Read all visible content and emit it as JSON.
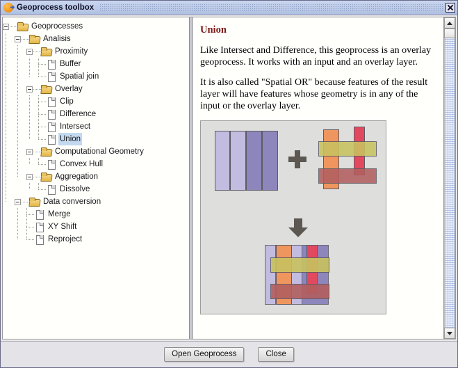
{
  "window": {
    "title": "Geoprocess toolbox",
    "app_icon": "gvsig-logo-icon",
    "close_label": "close-icon"
  },
  "tree": {
    "items": [
      {
        "label": "Geoprocesses",
        "depth": 0,
        "type": "folder",
        "expanded": true,
        "selected": false
      },
      {
        "label": "Analisis",
        "depth": 1,
        "type": "folder",
        "expanded": true,
        "selected": false
      },
      {
        "label": "Proximity",
        "depth": 2,
        "type": "folder",
        "expanded": true,
        "selected": false
      },
      {
        "label": "Buffer",
        "depth": 3,
        "type": "doc",
        "expanded": false,
        "selected": false
      },
      {
        "label": "Spatial join",
        "depth": 3,
        "type": "doc",
        "expanded": false,
        "selected": false
      },
      {
        "label": "Overlay",
        "depth": 2,
        "type": "folder",
        "expanded": true,
        "selected": false
      },
      {
        "label": "Clip",
        "depth": 3,
        "type": "doc",
        "expanded": false,
        "selected": false
      },
      {
        "label": "Difference",
        "depth": 3,
        "type": "doc",
        "expanded": false,
        "selected": false
      },
      {
        "label": "Intersect",
        "depth": 3,
        "type": "doc",
        "expanded": false,
        "selected": false
      },
      {
        "label": "Union",
        "depth": 3,
        "type": "doc",
        "expanded": false,
        "selected": true
      },
      {
        "label": "Computational Geometry",
        "depth": 2,
        "type": "folder",
        "expanded": true,
        "selected": false
      },
      {
        "label": "Convex Hull",
        "depth": 3,
        "type": "doc",
        "expanded": false,
        "selected": false
      },
      {
        "label": "Aggregation",
        "depth": 2,
        "type": "folder",
        "expanded": true,
        "selected": false
      },
      {
        "label": "Dissolve",
        "depth": 3,
        "type": "doc",
        "expanded": false,
        "selected": false
      },
      {
        "label": "Data conversion",
        "depth": 1,
        "type": "folder",
        "expanded": true,
        "selected": false
      },
      {
        "label": "Merge",
        "depth": 2,
        "type": "doc",
        "expanded": false,
        "selected": false
      },
      {
        "label": "XY Shift",
        "depth": 2,
        "type": "doc",
        "expanded": false,
        "selected": false
      },
      {
        "label": "Reproject",
        "depth": 2,
        "type": "doc",
        "expanded": false,
        "selected": false
      }
    ]
  },
  "doc": {
    "heading": "Union",
    "heading_color": "#7e1715",
    "paragraphs": [
      "Like Intersect and Difference, this geoprocess is an overlay geoprocess. It works with an input and an overlay layer.",
      "It is also called \"Spatial OR\" because features of the result layer will have features whose geometry is in any of the input or the overlay layer."
    ],
    "figure": {
      "name": "union-illustration",
      "background": "#dedfdd",
      "operator": "+",
      "arrow": "down-arrow-icon",
      "input_layer_colors": [
        "#c2bce0",
        "#c2bce0",
        "#8d86bc",
        "#8d86bc"
      ],
      "overlay_layer_colors": {
        "orange": "#ef965f",
        "olive": "#c8c260",
        "red": "#e2495f",
        "maroon": "#b25f5f"
      },
      "result_colors": {
        "light_purple": "#c2bce0",
        "dark_purple": "#8d86bc",
        "orange": "#ef965f",
        "salmon": "#ef9a86",
        "olive": "#c8c260",
        "rose": "#bb8087",
        "red": "#e2495f",
        "maroon": "#b25f5f",
        "gray_purple": "#90808a"
      }
    }
  },
  "scrollbar": {
    "up_arrow": "scroll-up-icon",
    "down_arrow": "scroll-down-icon",
    "thumb": "scroll-thumb"
  },
  "buttons": {
    "open": "Open Geoprocess",
    "close": "Close"
  }
}
